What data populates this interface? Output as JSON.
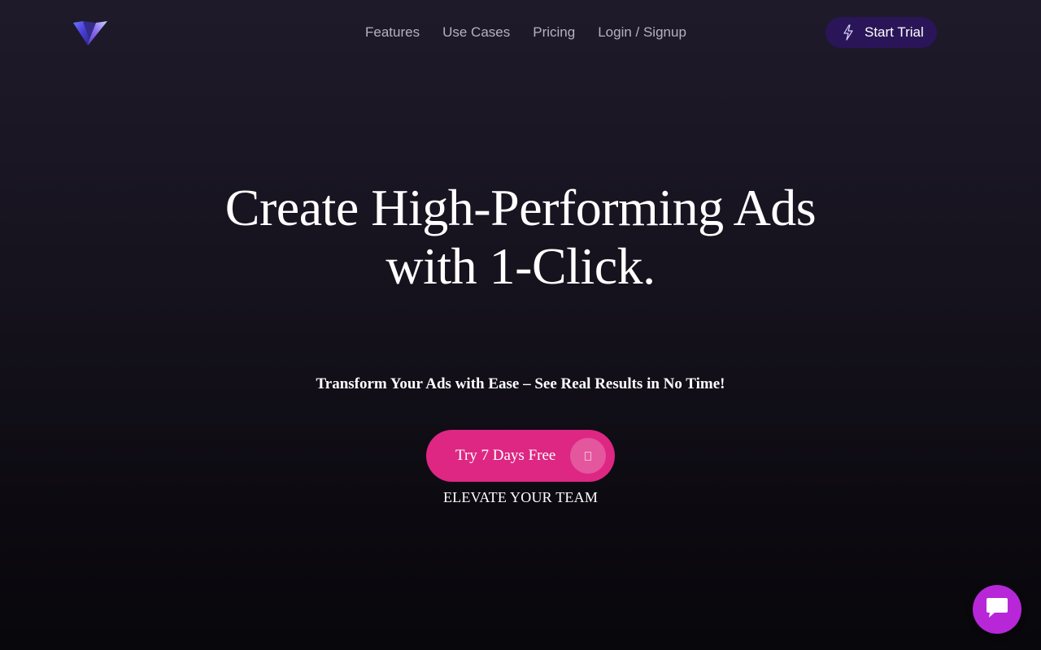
{
  "header": {
    "logo_icon": "v-logo-icon",
    "nav": [
      {
        "label": "Features"
      },
      {
        "label": "Use Cases"
      },
      {
        "label": "Pricing"
      },
      {
        "label": "Login / Signup"
      }
    ],
    "start_trial": {
      "label": "Start Trial",
      "icon": "lightning-bolt-icon",
      "background": "#2a1558"
    }
  },
  "hero": {
    "title_line1": "Create High-Performing Ads",
    "title_line2": "with 1-Click.",
    "subtitle": "Transform Your Ads with Ease – See Real Results in No Time!",
    "cta": {
      "label": "Try 7 Days Free",
      "icon": "arrow-icon",
      "background": "#dd2783"
    },
    "tagline": "ELEVATE YOUR TEAM"
  },
  "chat_widget": {
    "icon": "chat-bubble-icon",
    "background": "#b727d8"
  }
}
